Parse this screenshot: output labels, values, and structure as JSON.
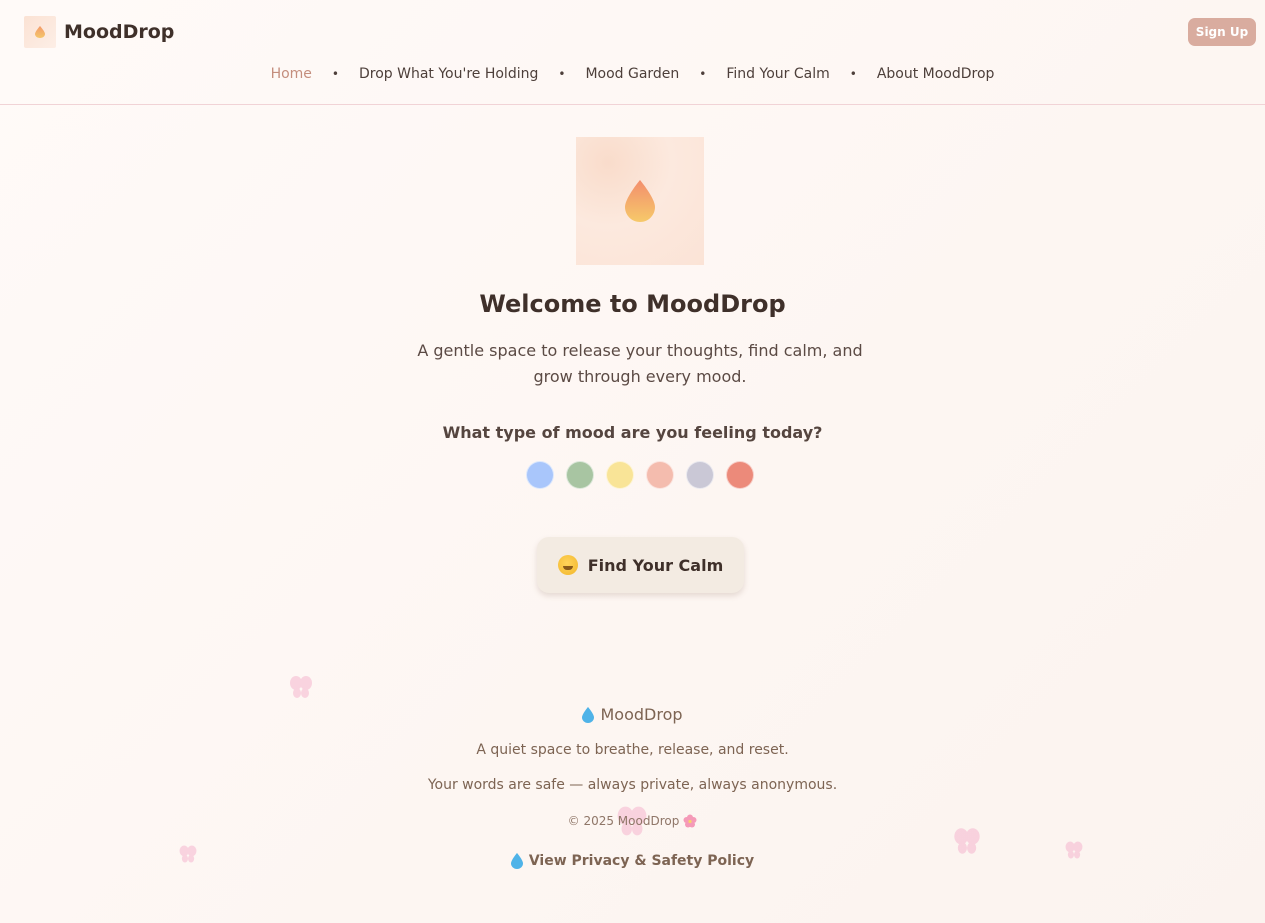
{
  "brand": {
    "name": "MoodDrop"
  },
  "header": {
    "signup_label": "Sign Up"
  },
  "nav": {
    "items": [
      {
        "label": "Home",
        "active": true
      },
      {
        "label": "Drop What You're Holding",
        "active": false
      },
      {
        "label": "Mood Garden",
        "active": false
      },
      {
        "label": "Find Your Calm",
        "active": false
      },
      {
        "label": "About MoodDrop",
        "active": false
      }
    ],
    "separator": "•"
  },
  "hero": {
    "title": "Welcome to MoodDrop",
    "tagline": "A gentle space to release your thoughts, find calm, and grow through every mood."
  },
  "mood": {
    "question": "What type of mood are you feeling today?",
    "colors": [
      "#a9c6fb",
      "#a8c5a2",
      "#f9e497",
      "#f4bcae",
      "#cac8d6",
      "#ec8a7a"
    ]
  },
  "cta": {
    "label": "Find Your Calm",
    "icon": "hugging-face-icon"
  },
  "footer": {
    "brand": "MoodDrop",
    "line1": "A quiet space to breathe, release, and reset.",
    "line2": "Your words are safe — always private, always anonymous.",
    "copyright": "© 2025 MoodDrop",
    "policy_label": "View Privacy & Safety Policy"
  },
  "colors": {
    "accent": "#c48e7d",
    "signup_bg": "#d9ac9f",
    "cta_bg": "#f3ebe2",
    "header_border": "#f1d3d6",
    "drop_blue": "#4fb3e8"
  }
}
